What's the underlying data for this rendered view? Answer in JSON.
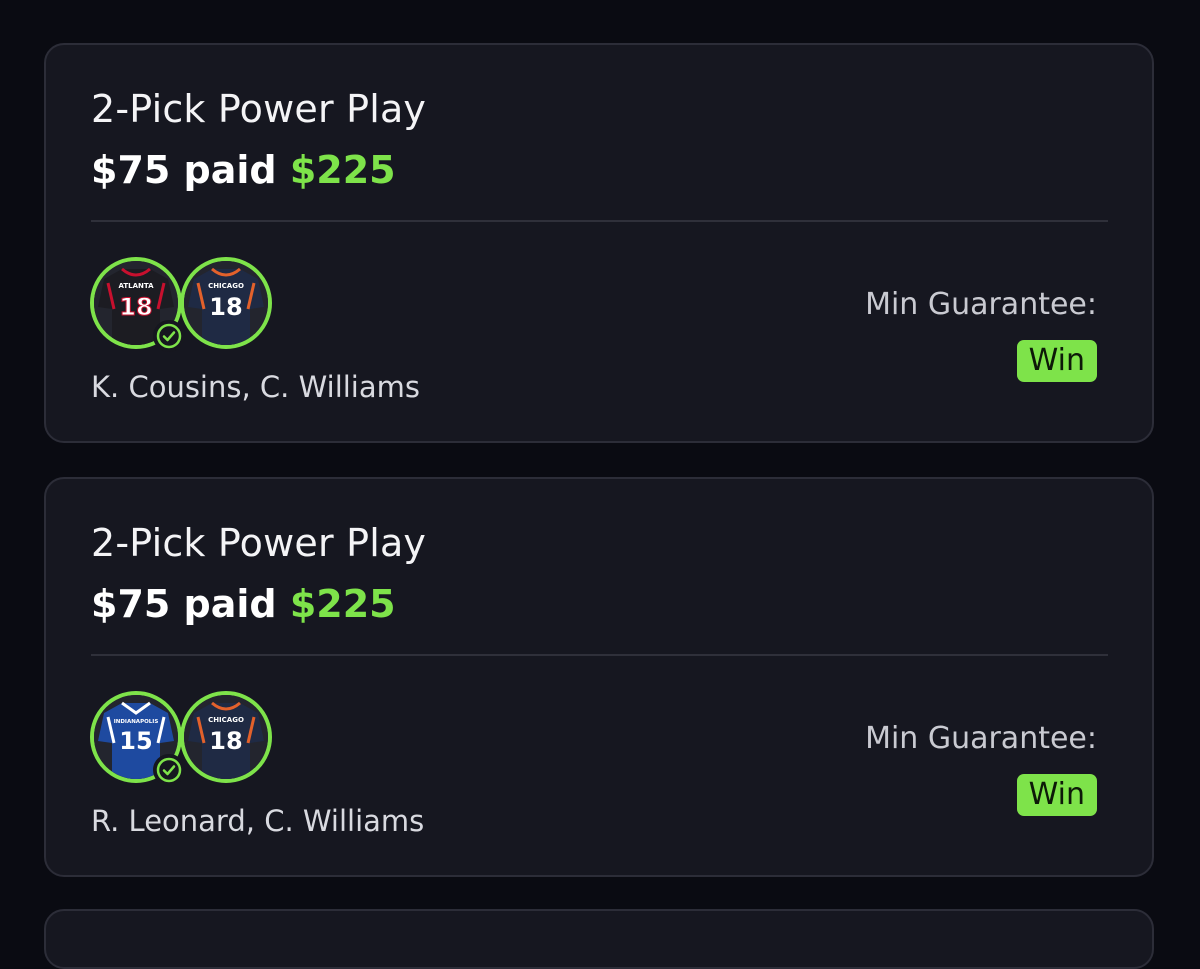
{
  "colors": {
    "background": "#0a0b12",
    "card": "#161720",
    "accent_green": "#7ee34a"
  },
  "entries": [
    {
      "title": "2-Pick Power Play",
      "paid": "$75 paid",
      "payout": "$225",
      "players": "K. Cousins, C. Williams",
      "guarantee_label": "Min Guarantee:",
      "guarantee_value": "Win",
      "jerseys": [
        {
          "team": "ATLANTA",
          "number": "18",
          "color": "#1c1c22",
          "trim": "#c8102e",
          "checked": true
        },
        {
          "team": "CHICAGO",
          "number": "18",
          "color": "#1f2a44",
          "trim": "#e3612b",
          "checked": false
        }
      ]
    },
    {
      "title": "2-Pick Power Play",
      "paid": "$75 paid",
      "payout": "$225",
      "players": "R. Leonard, C. Williams",
      "guarantee_label": "Min Guarantee:",
      "guarantee_value": "Win",
      "jerseys": [
        {
          "team": "INDIANAPOLIS",
          "number": "15",
          "color": "#1e4aa0",
          "trim": "#ffffff",
          "checked": true
        },
        {
          "team": "CHICAGO",
          "number": "18",
          "color": "#1f2a44",
          "trim": "#e3612b",
          "checked": false
        }
      ]
    }
  ]
}
